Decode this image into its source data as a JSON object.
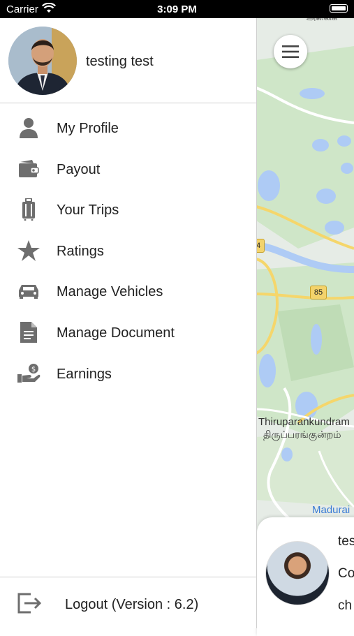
{
  "status_bar": {
    "carrier": "Carrier",
    "time": "3:09 PM"
  },
  "profile": {
    "name": "testing test"
  },
  "menu": [
    {
      "label": "My Profile",
      "icon": "person-icon"
    },
    {
      "label": "Payout",
      "icon": "wallet-icon"
    },
    {
      "label": "Your Trips",
      "icon": "luggage-icon"
    },
    {
      "label": "Ratings",
      "icon": "star-icon"
    },
    {
      "label": "Manage Vehicles",
      "icon": "car-icon"
    },
    {
      "label": "Manage Document",
      "icon": "document-icon"
    },
    {
      "label": "Earnings",
      "icon": "earnings-hand-icon"
    }
  ],
  "logout": {
    "label": "Logout (Version : 6.2)"
  },
  "map": {
    "labels": {
      "top": "அனைக",
      "place_en": "Thiruparankundram",
      "place_ta": "திருப்பரங்குன்றம்",
      "city": "Madurai"
    },
    "shields": {
      "road85": "85",
      "road4": "4"
    }
  },
  "trip_card": {
    "line1": "tes",
    "line2": "Co",
    "line3": "ch"
  },
  "colors": {
    "icon_gray": "#6e6e6e",
    "map_green": "#cfe6c8",
    "map_water": "#aecbf5",
    "road_yellow": "#f5d66b"
  }
}
